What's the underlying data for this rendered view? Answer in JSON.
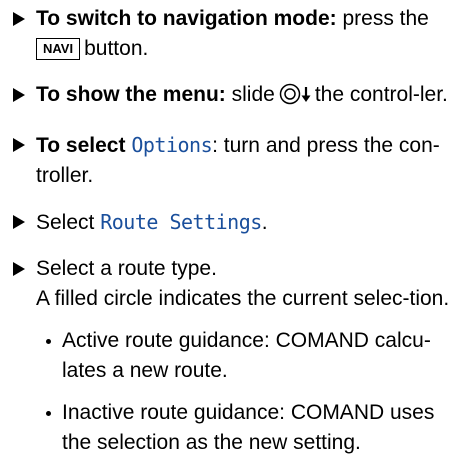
{
  "steps": [
    {
      "bold_label": "To switch to navigation mode:",
      "text_before": "press the",
      "key_label": "NAVI",
      "text_after": "button."
    },
    {
      "bold_label": "To show the menu:",
      "text_before": "slide",
      "icon": "controller-slide-down-icon",
      "text_after": "the control-ler."
    },
    {
      "bold_label": "To select",
      "code": "Options",
      "text_after": ": turn and press the con-troller."
    },
    {
      "text_before": "Select",
      "code": "Route Settings",
      "text_after": "."
    },
    {
      "text": "Select a route type.",
      "detail": "A filled circle indicates the current selec-tion.",
      "bullets": [
        "Active route guidance: COMAND calcu-lates a new route.",
        "Inactive route guidance: COMAND uses the selection as the new setting."
      ]
    }
  ],
  "colors": {
    "text": "#000000",
    "code": "#1a4f9c"
  }
}
